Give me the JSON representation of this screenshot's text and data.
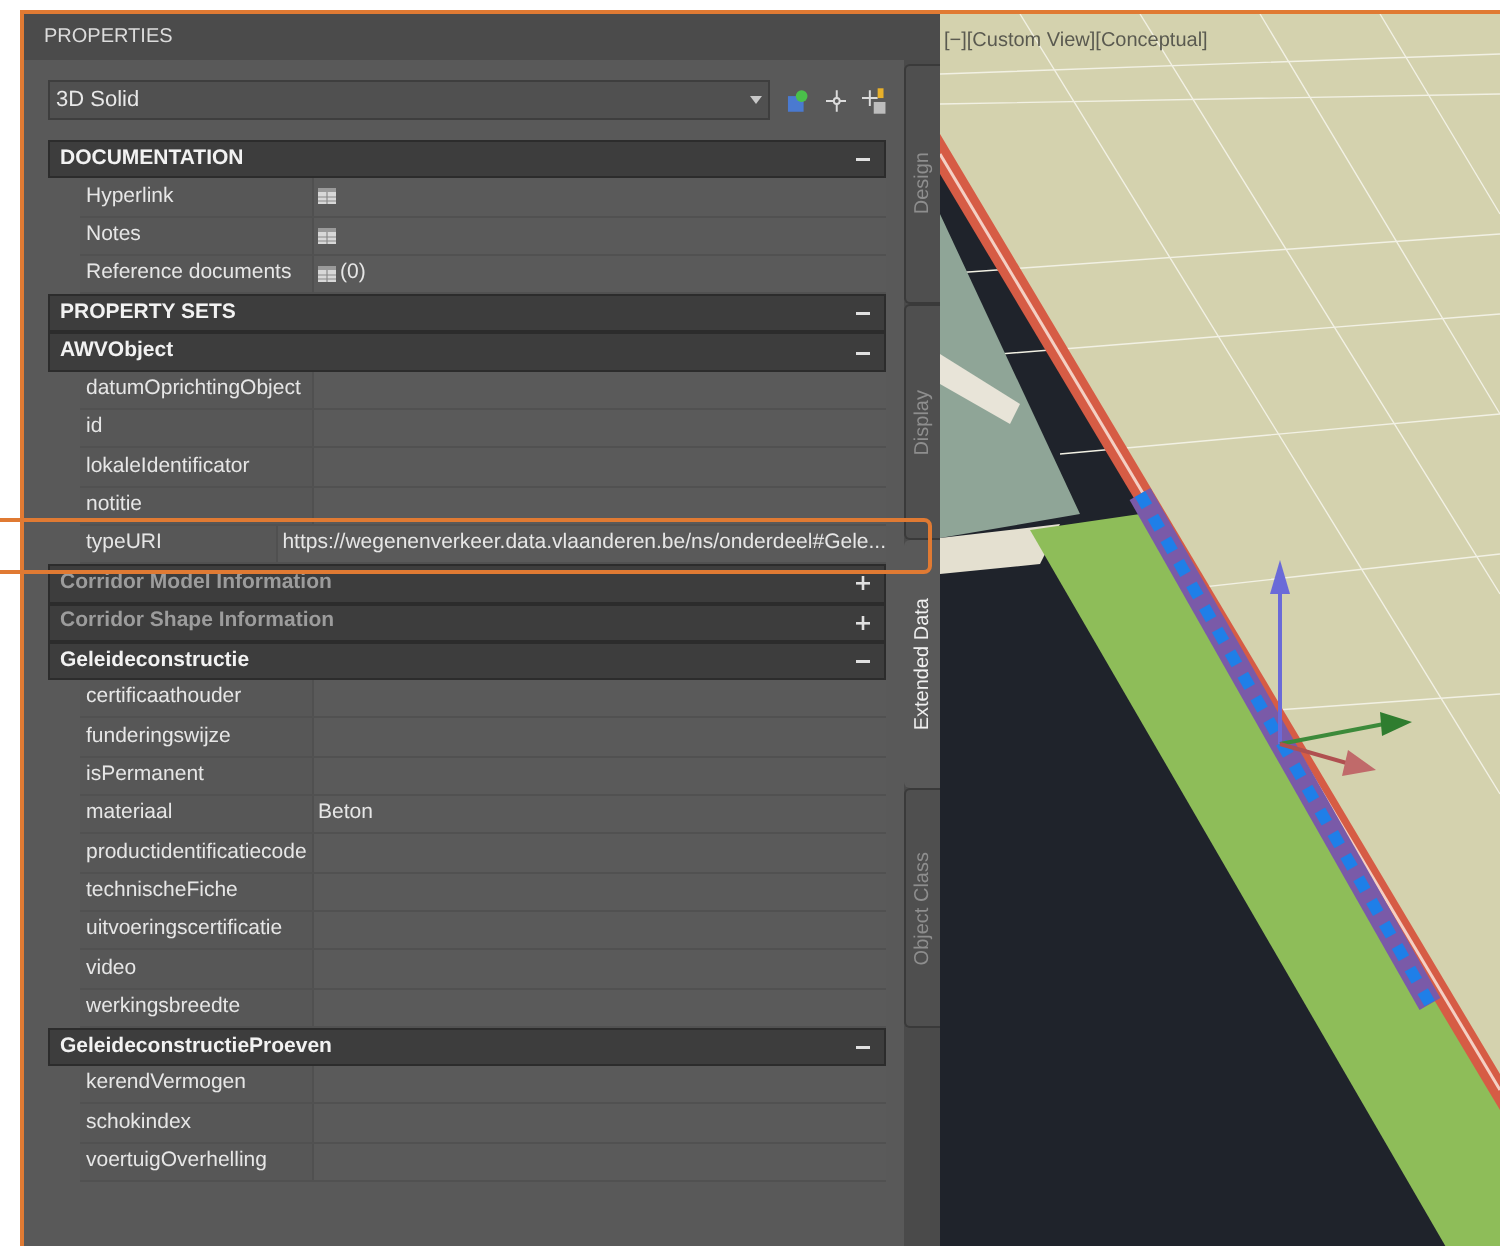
{
  "panel": {
    "title": "PROPERTIES"
  },
  "selector": {
    "value": "3D Solid"
  },
  "sections": [
    {
      "title": "DOCUMENTATION",
      "expanded": true,
      "rows": [
        {
          "label": "Hyperlink",
          "value_icon": true
        },
        {
          "label": "Notes",
          "value_icon": true
        },
        {
          "label": "Reference documents",
          "value_icon": true,
          "value": "(0)"
        }
      ]
    },
    {
      "title": "PROPERTY SETS",
      "expanded": true
    },
    {
      "title": "AWVObject",
      "expanded": true,
      "rows": [
        {
          "label": "datumOprichtingObject"
        },
        {
          "label": "id"
        },
        {
          "label": "lokaleIdentificator"
        },
        {
          "label": "notitie"
        },
        {
          "label": "typeURI",
          "value": "https://wegenenverkeer.data.vlaanderen.be/ns/onderdeel#Gele...",
          "highlighted": true
        }
      ]
    },
    {
      "title": "Corridor Model Information",
      "expanded": false
    },
    {
      "title": "Corridor Shape Information",
      "expanded": false
    },
    {
      "title": "Geleideconstructie",
      "expanded": true,
      "rows": [
        {
          "label": "certificaathouder"
        },
        {
          "label": "funderingswijze"
        },
        {
          "label": "isPermanent"
        },
        {
          "label": "materiaal",
          "value": "Beton"
        },
        {
          "label": "productidentificatiecode"
        },
        {
          "label": "technischeFiche"
        },
        {
          "label": "uitvoeringscertificatie"
        },
        {
          "label": "video"
        },
        {
          "label": "werkingsbreedte"
        }
      ]
    },
    {
      "title": "GeleideconstructieProeven",
      "expanded": true,
      "rows": [
        {
          "label": "kerendVermogen"
        },
        {
          "label": "schokindex"
        },
        {
          "label": "voertuigOverhelling"
        }
      ]
    }
  ],
  "tabs": [
    {
      "label": "Design",
      "selected": false
    },
    {
      "label": "Display",
      "selected": false
    },
    {
      "label": "Extended Data",
      "selected": true
    },
    {
      "label": "Object Class",
      "selected": false
    }
  ],
  "viewport": {
    "label": "[−][Custom View][Conceptual]"
  }
}
